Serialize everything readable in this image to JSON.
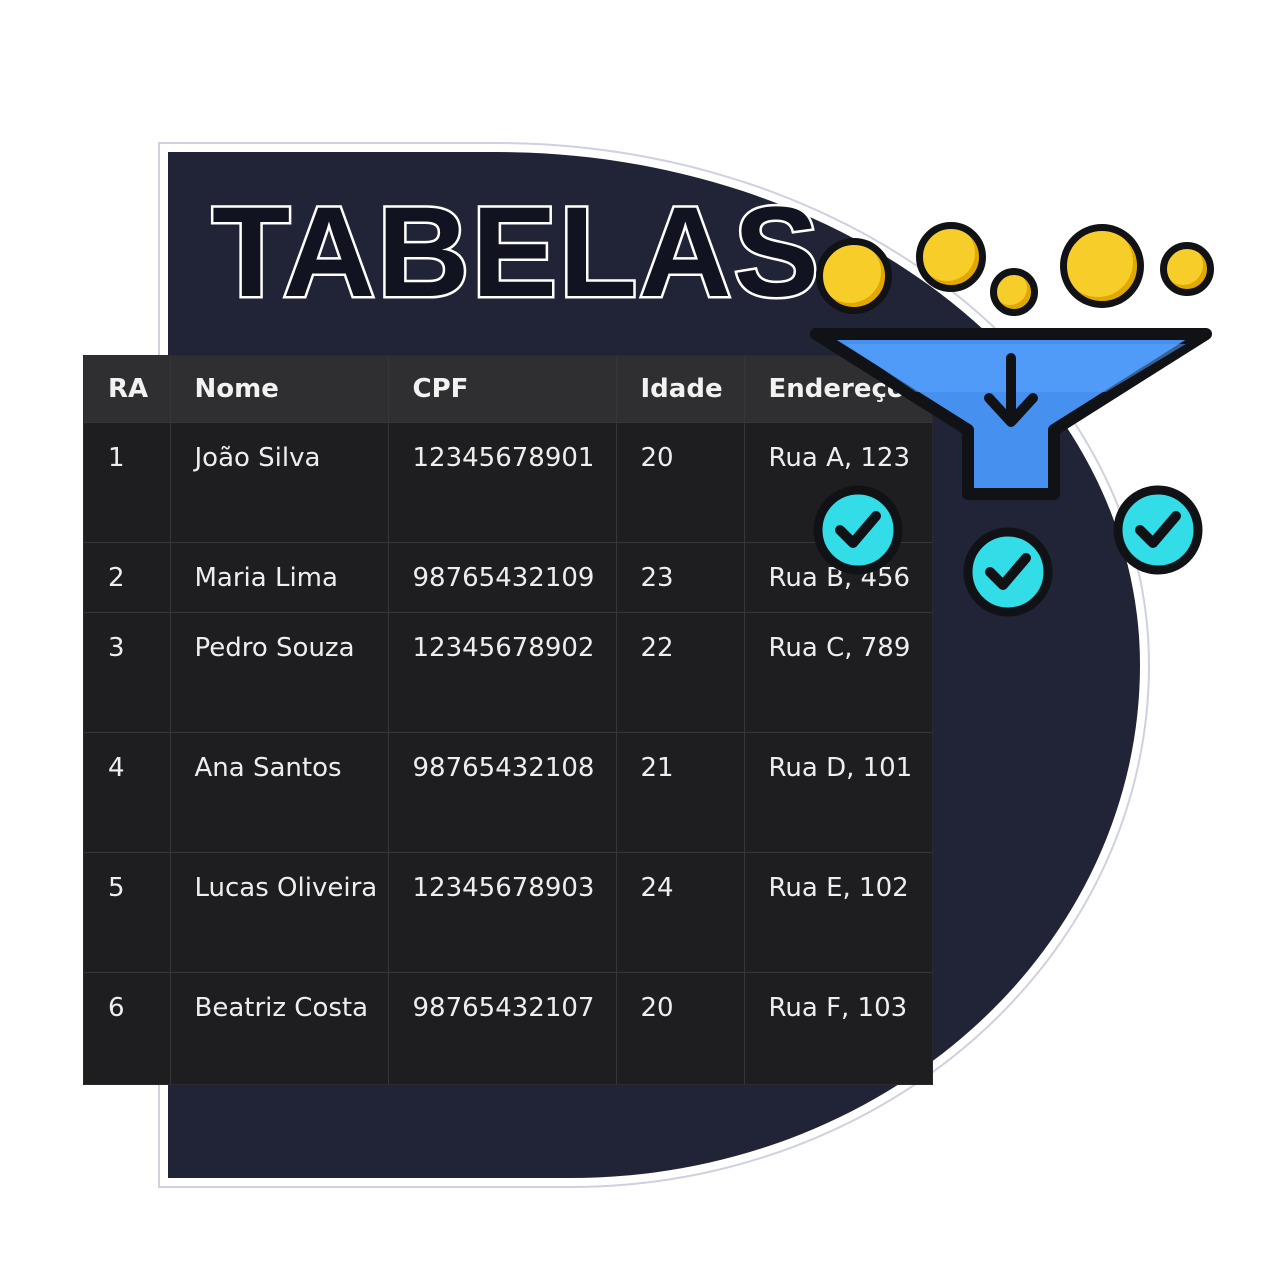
{
  "title": "TABELAS",
  "table": {
    "headers": [
      "RA",
      "Nome",
      "CPF",
      "Idade",
      "Endereço"
    ],
    "rows": [
      [
        "1",
        "João Silva",
        "12345678901",
        "20",
        "Rua A, 123"
      ],
      [
        "2",
        "Maria Lima",
        "98765432109",
        "23",
        "Rua B, 456"
      ],
      [
        "3",
        "Pedro Souza",
        "12345678902",
        "22",
        "Rua C, 789"
      ],
      [
        "4",
        "Ana Santos",
        "98765432108",
        "21",
        "Rua D, 101"
      ],
      [
        "5",
        "Lucas Oliveira",
        "12345678903",
        "24",
        "Rua E, 102"
      ],
      [
        "6",
        "Beatriz Costa",
        "98765432107",
        "20",
        "Rua F, 103"
      ]
    ]
  },
  "icons": {
    "funnel": "funnel-icon",
    "check": "check-circle-icon",
    "coin": "coin-icon"
  },
  "colors": {
    "card_background": "#212337",
    "table_header": "#2f2f31",
    "table_cell": "#1e1e20",
    "funnel": "#4690f0",
    "check": "#33dde8",
    "coin": "#f7cd2a"
  }
}
